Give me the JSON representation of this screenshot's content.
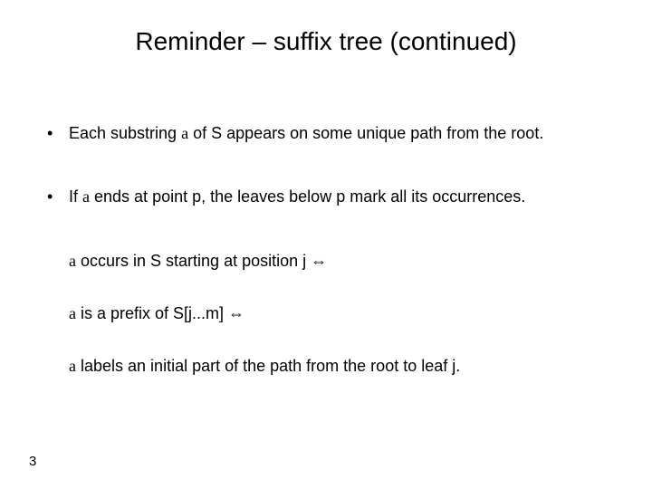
{
  "title": "Reminder – suffix tree (continued)",
  "sym": {
    "alpha": "a",
    "iff": "⇔"
  },
  "bullets": {
    "b1a": "Each substring ",
    "b1b": "   of S appears on some unique path from the root.",
    "b2a": "If ",
    "b2b": " ends at point p, the leaves below p mark all its occurrences."
  },
  "indent": {
    "l1a": " occurs in S starting at position j ",
    "l2a": " is a prefix of S[j...m] ",
    "l3a": " labels an initial part of the path from the root to leaf j."
  },
  "bulletdot": "•",
  "pagenum": "3"
}
